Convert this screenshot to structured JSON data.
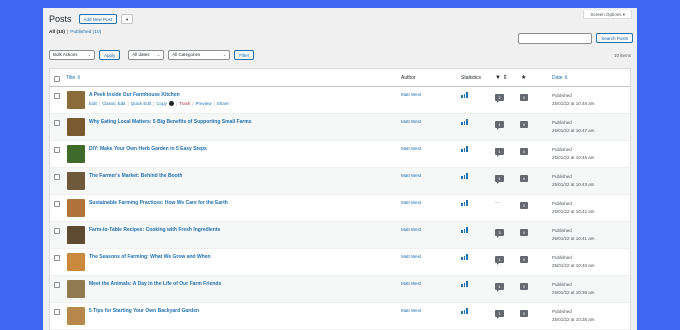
{
  "header": {
    "title": "Posts",
    "add_new_label": "Add New Post",
    "add_new_dropdown": "▾",
    "screen_options_label": "Screen Options ▾"
  },
  "views": {
    "all_label": "All",
    "all_count": "(10)",
    "separator": "|",
    "published_label": "Published",
    "published_count": "(10)"
  },
  "search": {
    "input_value": "",
    "button_label": "Search Posts"
  },
  "filters": {
    "bulk_actions": "Bulk Actions",
    "apply_label": "Apply",
    "dates": "All dates",
    "categories": "All Categories",
    "filter_label": "Filter"
  },
  "items_count": "10 items",
  "columns": {
    "title": "Title ⇕",
    "author": "Author",
    "statistics": "Statistics",
    "date": "Date ⇕"
  },
  "row_actions": {
    "edit": "Edit",
    "classic_edit": "Classic Edit",
    "quick_edit": "Quick Edit",
    "copy": "Copy",
    "trash": "Trash",
    "preview": "Preview",
    "share": "Share",
    "separator": "|"
  },
  "posts": [
    {
      "title": "A Peek Inside Our Farmhouse Kitchen",
      "author": "Matt West",
      "comments": "2",
      "stars": "0",
      "status": "Published",
      "date": "25/01/22 at 10:48 am",
      "thumb_color": "#8a6b3c"
    },
    {
      "title": "Why Eating Local Matters: 5 Big Benefits of Supporting Small Farms",
      "author": "Matt West",
      "comments": "1",
      "stars": "0",
      "status": "Published",
      "date": "25/01/22 at 10:47 am",
      "thumb_color": "#7a5a2e"
    },
    {
      "title": "DIY: Make Your Own Herb Garden in 5 Easy Steps",
      "author": "Matt West",
      "comments": "1",
      "stars": "0",
      "status": "Published",
      "date": "25/01/22 at 10:45 am",
      "thumb_color": "#3f6b2a"
    },
    {
      "title": "The Farmer's Market: Behind the Booth",
      "author": "Matt West",
      "comments": "1",
      "stars": "0",
      "status": "Published",
      "date": "25/01/22 at 10:43 am",
      "thumb_color": "#6e5a3a"
    },
    {
      "title": "Sustainable Farming Practices: How We Care for the Earth",
      "author": "Matt West",
      "comments": "—",
      "stars": "0",
      "status": "Published",
      "date": "25/01/22 at 10:42 am",
      "thumb_color": "#b0743a"
    },
    {
      "title": "Farm-to-Table Recipes: Cooking with Fresh Ingredients",
      "author": "Matt West",
      "comments": "3",
      "stars": "0",
      "status": "Published",
      "date": "25/01/22 at 10:41 am",
      "thumb_color": "#5e4a30"
    },
    {
      "title": "The Seasons of Farming: What We Grow and When",
      "author": "Matt West",
      "comments": "1",
      "stars": "0",
      "status": "Published",
      "date": "25/01/22 at 10:40 am",
      "thumb_color": "#c98a3e"
    },
    {
      "title": "Meet the Animals: A Day in the Life of Our Farm Friends",
      "author": "Matt West",
      "comments": "1",
      "stars": "0",
      "status": "Published",
      "date": "25/01/22 at 10:39 am",
      "thumb_color": "#8f7a52"
    },
    {
      "title": "5 Tips for Starting Your Own Backyard Garden",
      "author": "Matt West",
      "comments": "1",
      "stars": "0",
      "status": "Published",
      "date": "25/01/22 at 10:38 am",
      "thumb_color": "#b7884a"
    }
  ],
  "colors": {
    "background": "#3e68f3",
    "link": "#2271b1",
    "trash": "#b32d2e"
  }
}
